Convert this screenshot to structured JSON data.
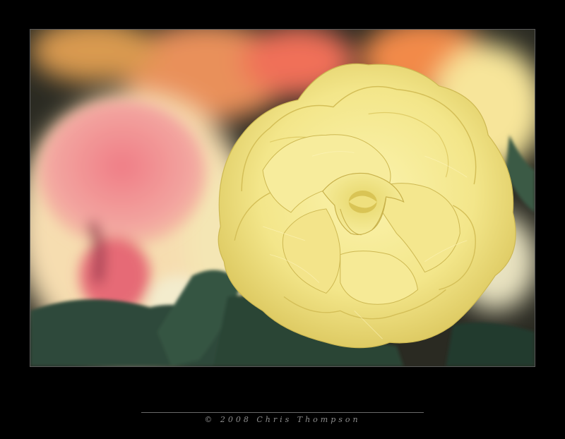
{
  "photo": {
    "subject": "yellow-begonia-flower",
    "palette": {
      "yellow_petal": "#f3e68a",
      "yellow_shadow": "#d9c45a",
      "pink_petal": "#f08c8c",
      "orange_blur": "#f0a060",
      "leaf_green": "#2f4a3a",
      "background_dark": "#2a2a22",
      "frame_border": "#5a5a5a"
    }
  },
  "caption": {
    "text": "© 2008 Chris Thompson"
  }
}
